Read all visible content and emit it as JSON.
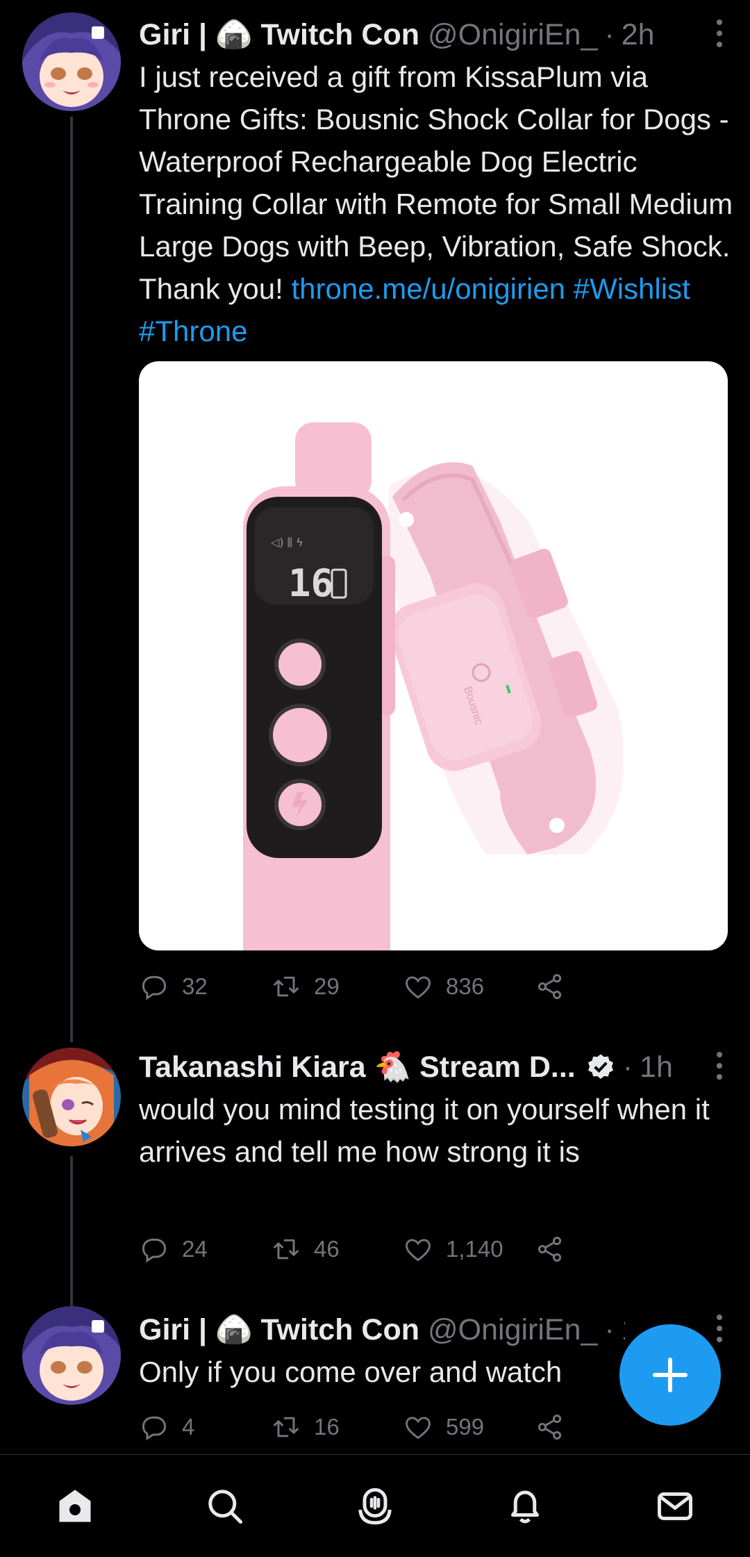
{
  "tweets": [
    {
      "name": "Giri | 🍙 Twitch Con",
      "handle": "@OnigiriEn_",
      "dot": "·",
      "time": "2h",
      "text": "I just received a gift from KissaPlum via Throne Gifts: Bousnic Shock Collar for Dogs - Waterproof Rechargeable Dog Electric Training Collar with Remote for Small Medium Large Dogs with Beep, Vibration, Safe Shock. Thank you!",
      "links": [
        "throne.me/u/onigirien",
        "#Wishlist",
        "#Throne"
      ],
      "media_screen_text": "16",
      "media_brand": "Bousnic",
      "replies": "32",
      "retweets": "29",
      "likes": "836"
    },
    {
      "name": "Takanashi Kiara 🐔 Stream D...",
      "handle": "",
      "dot": "·",
      "time": "1h",
      "text": "would you mind testing it on yourself when it arrives and tell me how strong it is",
      "replies": "24",
      "retweets": "46",
      "likes": "1,140"
    },
    {
      "name": "Giri | 🍙 Twitch Con",
      "handle": "@OnigiriEn_",
      "dot": "·",
      "time": "1h",
      "text": "Only if you come over and watch",
      "replies": "4",
      "retweets": "16",
      "likes": "599"
    }
  ],
  "colors": {
    "background": "#000000",
    "text": "#e7e9ea",
    "muted": "#71767b",
    "accent": "#1d9bf0",
    "product_pink": "#f4c2d4"
  },
  "icons": {
    "reply": "reply-icon",
    "retweet": "retweet-icon",
    "like": "heart-icon",
    "share": "share-icon",
    "compose": "plus-icon",
    "tabs": [
      "home-icon",
      "search-icon",
      "spaces-icon",
      "notifications-icon",
      "messages-icon"
    ]
  }
}
